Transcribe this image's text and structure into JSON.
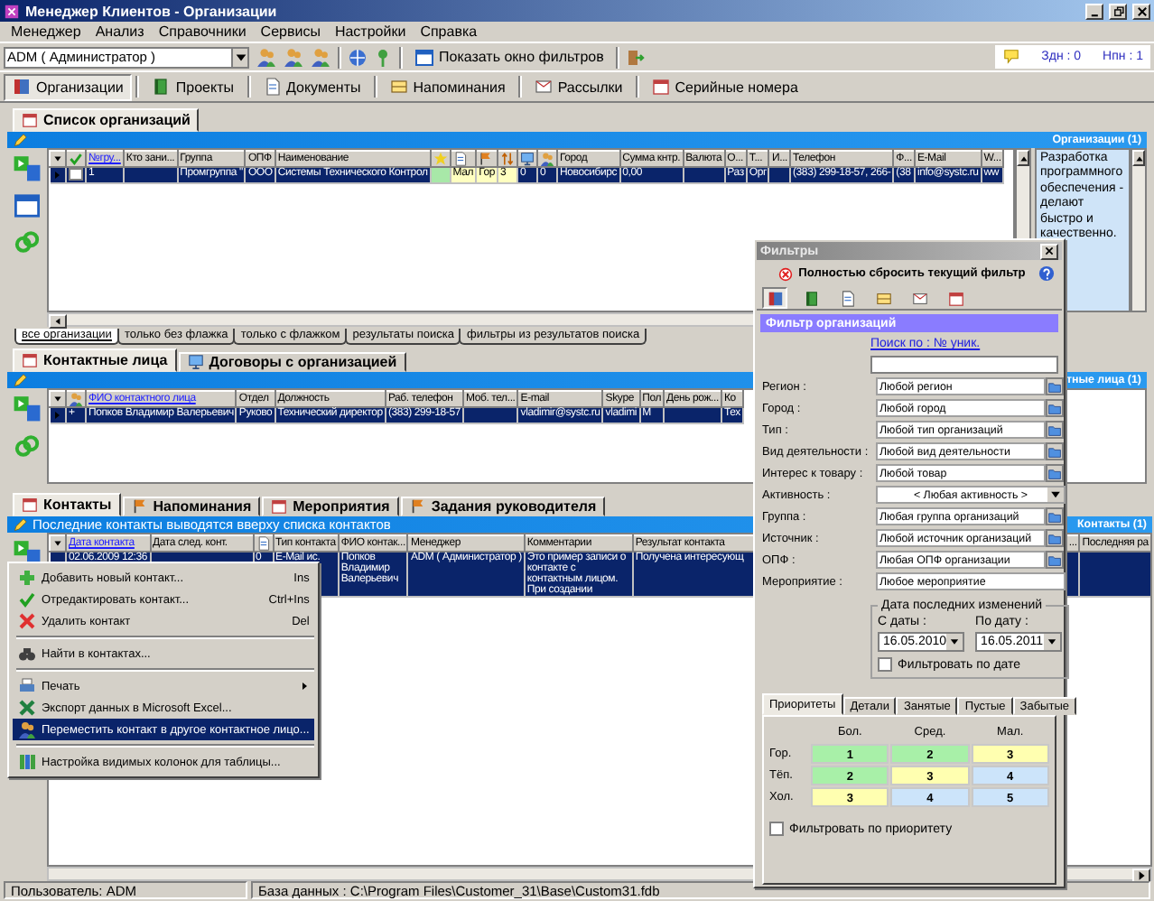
{
  "window": {
    "title": "Менеджер Клиентов - Организации"
  },
  "menu": [
    "Менеджер",
    "Анализ",
    "Справочники",
    "Сервисы",
    "Настройки",
    "Справка"
  ],
  "toolbar": {
    "user": "ADM ( Администратор )",
    "filter_button": "Показать окно фильтров",
    "counters": [
      "Здн : 0",
      "Нпн : 1"
    ]
  },
  "sections": [
    {
      "label": "Организации",
      "selected": true
    },
    {
      "label": "Проекты",
      "selected": false
    },
    {
      "label": "Документы",
      "selected": false
    },
    {
      "label": "Напоминания",
      "selected": false
    },
    {
      "label": "Рассылки",
      "selected": false
    },
    {
      "label": "Серийные номера",
      "selected": false
    }
  ],
  "org_panel": {
    "tabs": [
      {
        "label": "Список организаций",
        "selected": true
      }
    ],
    "count": "Организации (1)",
    "columns": [
      {
        "kind": "check"
      },
      {
        "kind": "text",
        "label": "№гру...",
        "sorted": true
      },
      {
        "kind": "text",
        "label": "Кто зани...",
        "sorted": false
      },
      {
        "kind": "text",
        "label": "Группа",
        "sorted": false
      },
      {
        "kind": "text",
        "label": "ОПФ",
        "sorted": false
      },
      {
        "kind": "text",
        "label": "Наименование",
        "sorted": false
      },
      {
        "kind": "icon"
      },
      {
        "kind": "icon"
      },
      {
        "kind": "icon"
      },
      {
        "kind": "icon"
      },
      {
        "kind": "icon"
      },
      {
        "kind": "icon"
      },
      {
        "kind": "text",
        "label": "Город",
        "sorted": false
      },
      {
        "kind": "text",
        "label": "Сумма кнтр.",
        "sorted": false
      },
      {
        "kind": "text",
        "label": "Валюта",
        "sorted": false
      },
      {
        "kind": "text",
        "label": "О...",
        "sorted": false
      },
      {
        "kind": "text",
        "label": "Т...",
        "sorted": false
      },
      {
        "kind": "text",
        "label": "И...",
        "sorted": false
      },
      {
        "kind": "text",
        "label": "Телефон",
        "sorted": false
      },
      {
        "kind": "text",
        "label": "Ф...",
        "sorted": false
      },
      {
        "kind": "text",
        "label": "E-Mail",
        "sorted": false
      },
      {
        "kind": "text",
        "label": "W...",
        "sorted": false
      }
    ],
    "rows": [
      {
        "selected": true,
        "cells": [
          {
            "checked": false
          },
          "1",
          null,
          "Промгруппа \"",
          "ООО",
          "Системы Технического Контрол",
          {
            "text": null,
            "color": "#a8e8a8"
          },
          {
            "text": "Мал",
            "color": "#ffffc0"
          },
          {
            "text": "Гор",
            "color": "#ffffc0"
          },
          {
            "text": "3",
            "color": "#ffffc0"
          },
          "0",
          "0",
          "Новосибирс",
          "0,00",
          null,
          "Раз",
          "Орг",
          null,
          "(383) 299-18-57, 266-",
          "(38",
          "info@systc.ru",
          "ww"
        ]
      }
    ],
    "note": "Разработка программного обеспечения - делают быстро и качественно.",
    "filters": [
      {
        "label": "все организации",
        "selected": true
      },
      {
        "label": "только без флажка",
        "selected": false
      },
      {
        "label": "только с флажком",
        "selected": false
      },
      {
        "label": "результаты поиска",
        "selected": false
      },
      {
        "label": "фильтры из результатов поиска",
        "selected": false
      }
    ]
  },
  "contacts_panel": {
    "tabs": [
      {
        "label": "Контактные лица",
        "selected": true
      },
      {
        "label": "Договоры с организацией",
        "selected": false
      }
    ],
    "count": "тные лица (1)",
    "columns": [
      {
        "kind": "icon"
      },
      {
        "kind": "text",
        "label": "ФИО контактного лица",
        "sorted": true
      },
      {
        "kind": "text",
        "label": "Отдел",
        "sorted": false
      },
      {
        "kind": "text",
        "label": "Должность",
        "sorted": false
      },
      {
        "kind": "text",
        "label": "Раб. телефон",
        "sorted": false
      },
      {
        "kind": "text",
        "label": "Моб. тел...",
        "sorted": false
      },
      {
        "kind": "text",
        "label": "E-mail",
        "sorted": false
      },
      {
        "kind": "text",
        "label": "Skype",
        "sorted": false
      },
      {
        "kind": "text",
        "label": "Пол",
        "sorted": false
      },
      {
        "kind": "text",
        "label": "День рож...",
        "sorted": false
      },
      {
        "kind": "text",
        "label": "Ко",
        "sorted": false
      }
    ],
    "rows": [
      {
        "selected": true,
        "cells": [
          "+",
          "Попков Владимир Валерьевич",
          "Руково",
          "Технический директор",
          "(383) 299-18-57",
          null,
          "vladimir@systc.ru",
          "vladimi",
          "М",
          null,
          "Тех"
        ]
      }
    ]
  },
  "activity_panel": {
    "tabs": [
      {
        "label": "Контакты",
        "selected": true
      },
      {
        "label": "Напоминания",
        "selected": false
      },
      {
        "label": "Мероприятия",
        "selected": false
      },
      {
        "label": "Задания руководителя",
        "selected": false
      }
    ],
    "hint": "Последние контакты выводятся вверху списка контактов",
    "count": "Контакты (1)",
    "columns": [
      {
        "kind": "text",
        "label": "Дата контакта",
        "sorted": true
      },
      {
        "kind": "text",
        "label": "Дата след. конт.",
        "sorted": false
      },
      {
        "kind": "icon"
      },
      {
        "kind": "text",
        "label": "Тип контакта",
        "sorted": false
      },
      {
        "kind": "text",
        "label": "ФИО контак...",
        "sorted": false
      },
      {
        "kind": "text",
        "label": "Менеджер",
        "sorted": false
      },
      {
        "kind": "text",
        "label": "Комментарии",
        "sorted": false
      },
      {
        "kind": "text",
        "label": "Результат контакта",
        "sorted": false
      },
      {
        "kind": "text",
        "label": "...",
        "sorted": false
      },
      {
        "kind": "text",
        "label": "Последняя ра",
        "sorted": false
      }
    ],
    "rows": [
      {
        "selected": true,
        "cells": [
          "02.06.2009 12:36",
          null,
          "0",
          "E-Mail ис.",
          "Попков Владимир Валерьевич",
          "ADM ( Администратор )",
          "Это пример записи о контакте с контактным лицом. При создании",
          "Получена интересующ",
          null,
          null
        ]
      }
    ]
  },
  "context_menu": [
    {
      "kind": "item",
      "label": "Добавить новый контакт...",
      "shortcut": "Ins",
      "selected": false
    },
    {
      "kind": "item",
      "label": "Отредактировать контакт...",
      "shortcut": "Ctrl+Ins",
      "selected": false
    },
    {
      "kind": "item",
      "label": "Удалить контакт",
      "shortcut": "Del",
      "selected": false
    },
    {
      "kind": "separator"
    },
    {
      "kind": "item",
      "label": "Найти в контактах...",
      "selected": false
    },
    {
      "kind": "separator"
    },
    {
      "kind": "submenu",
      "label": "Печать",
      "selected": false
    },
    {
      "kind": "item",
      "label": "Экспорт данных в Microsoft Excel...",
      "selected": false
    },
    {
      "kind": "item",
      "label": "Переместить контакт в другое контактное лицо...",
      "selected": true
    },
    {
      "kind": "separator"
    },
    {
      "kind": "item",
      "label": "Настройка видимых колонок для таблицы...",
      "selected": false
    }
  ],
  "filter_window": {
    "title": "Фильтры",
    "reset": "Полностью сбросить текущий фильтр",
    "icon_tabs": [
      {
        "selected": true
      },
      {
        "selected": false
      },
      {
        "selected": false
      },
      {
        "selected": false
      },
      {
        "selected": false
      },
      {
        "selected": false
      }
    ],
    "heading": "Фильтр организаций",
    "search_link": "Поиск по : № уник.",
    "fields": [
      {
        "label": "Регион :",
        "value": "Любой регион",
        "kind": "picker"
      },
      {
        "label": "Город :",
        "value": "Любой город",
        "kind": "picker"
      },
      {
        "label": "Тип :",
        "value": "Любой тип организаций",
        "kind": "picker"
      },
      {
        "label": "Вид деятельности :",
        "value": "Любой вид деятельности",
        "kind": "picker"
      },
      {
        "label": "Интерес к товару :",
        "value": "Любой товар",
        "kind": "picker"
      },
      {
        "label": "Активность :",
        "value": "< Любая активность >",
        "kind": "dropdown"
      },
      {
        "label": "Группа :",
        "value": "Любая группа организаций",
        "kind": "picker"
      },
      {
        "label": "Источник :",
        "value": "Любой источник организаций",
        "kind": "picker"
      },
      {
        "label": "ОПФ :",
        "value": "Любая ОПФ организации",
        "kind": "picker"
      },
      {
        "label": "Мероприятие :",
        "value": "Любое мероприятие",
        "kind": "text"
      }
    ],
    "date_group": {
      "title": "Дата последних изменений",
      "from_label": "С даты :",
      "from": "16.05.2010",
      "to_label": "По дату :",
      "to": "16.05.2011",
      "checkbox": {
        "label": "Фильтровать по дате",
        "checked": false
      }
    },
    "tabs": [
      {
        "label": "Приоритеты",
        "selected": true
      },
      {
        "label": "Детали",
        "selected": false
      },
      {
        "label": "Занятые",
        "selected": false
      },
      {
        "label": "Пустые",
        "selected": false
      },
      {
        "label": "Забытые",
        "selected": false
      }
    ],
    "priority": {
      "columns": [
        "Бол.",
        "Сред.",
        "Мал."
      ],
      "rows": [
        {
          "label": "Гор.",
          "cells": [
            {
              "text": "1",
              "color": "#a8f0a8"
            },
            {
              "text": "2",
              "color": "#a8f0a8"
            },
            {
              "text": "3",
              "color": "#ffffb0"
            }
          ]
        },
        {
          "label": "Тёп.",
          "cells": [
            {
              "text": "2",
              "color": "#a8f0a8"
            },
            {
              "text": "3",
              "color": "#ffffb0"
            },
            {
              "text": "4",
              "color": "#cce4fa"
            }
          ]
        },
        {
          "label": "Хол.",
          "cells": [
            {
              "text": "3",
              "color": "#ffffb0"
            },
            {
              "text": "4",
              "color": "#cce4fa"
            },
            {
              "text": "5",
              "color": "#cce4fa"
            }
          ]
        }
      ],
      "checkbox": {
        "label": "Фильтровать по приоритету",
        "checked": false
      }
    }
  },
  "status_bar": [
    "Пользователь: ADM",
    "База данных : C:\\Program Files\\Customer_31\\Base\\Custom31.fdb"
  ]
}
